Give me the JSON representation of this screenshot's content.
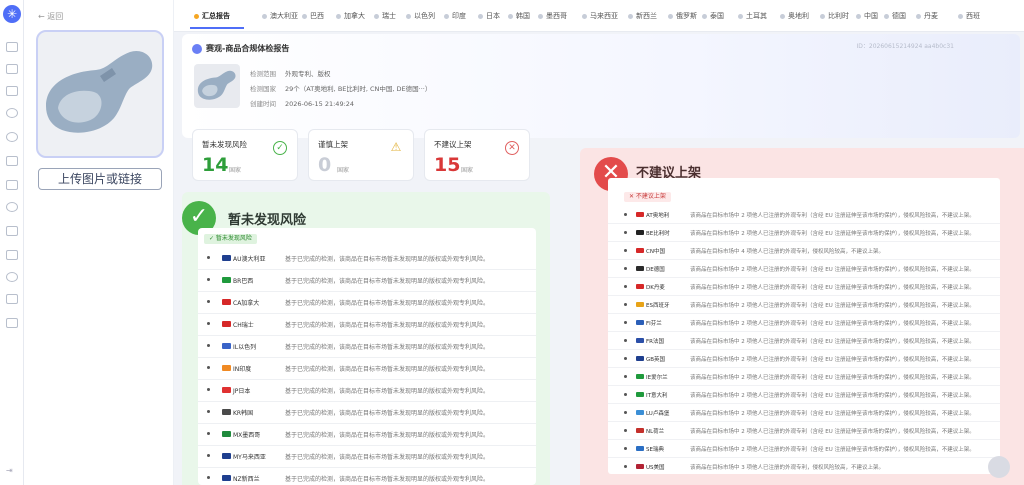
{
  "sidebar_left": {
    "back_label": "← 返回",
    "upload_button": "上传图片或链接"
  },
  "tabs": [
    {
      "label": "汇总报告",
      "active": true
    },
    {
      "label": "澳大利亚"
    },
    {
      "label": "巴西"
    },
    {
      "label": "加拿大"
    },
    {
      "label": "瑞士"
    },
    {
      "label": "以色列"
    },
    {
      "label": "印度"
    },
    {
      "label": "日本"
    },
    {
      "label": "韩国"
    },
    {
      "label": "墨西哥"
    },
    {
      "label": "马来西亚"
    },
    {
      "label": "新西兰"
    },
    {
      "label": "俄罗斯"
    },
    {
      "label": "泰国"
    },
    {
      "label": "土耳其"
    },
    {
      "label": "奥地利"
    },
    {
      "label": "比利时"
    },
    {
      "label": "中国"
    },
    {
      "label": "德国"
    },
    {
      "label": "丹麦"
    },
    {
      "label": "西班"
    }
  ],
  "report": {
    "title": "赛观-商品合规体检报告",
    "report_id": "ID：20260615214924 aa4b0c31",
    "scope_label": "检测范围",
    "scope_value": "外观专利、版权",
    "countries_label": "检测国家",
    "countries_value": "29个（AT奥地利, BE比利时, CN中国, DE德国···）",
    "created_label": "创建时间",
    "created_value": "2026-06-15 21:49:24"
  },
  "summary_cards": [
    {
      "title": "暂未发现风险",
      "count": "14",
      "unit": "国家",
      "color": "#2e9e3a",
      "icon": "check-circle-icon"
    },
    {
      "title": "谨慎上架",
      "count": "0",
      "unit": "国家",
      "color": "#c9cdd6",
      "icon": "warning-triangle-icon"
    },
    {
      "title": "不建议上架",
      "count": "15",
      "unit": "国家",
      "color": "#d93838",
      "icon": "x-circle-icon"
    }
  ],
  "no_risk": {
    "heading": "暂未发现风险",
    "badge": "✓ 暂未发现风险",
    "rows": [
      {
        "country": "AU澳大利亚",
        "flag": "#1f3f8f",
        "desc": "基于已完成的检测，该商品在目标市场暂未发现明显的版权或外观专利风险。"
      },
      {
        "country": "BR巴西",
        "flag": "#1f9a3c",
        "desc": "基于已完成的检测，该商品在目标市场暂未发现明显的版权或外观专利风险。"
      },
      {
        "country": "CA加拿大",
        "flag": "#d62828",
        "desc": "基于已完成的检测，该商品在目标市场暂未发现明显的版权或外观专利风险。"
      },
      {
        "country": "CH瑞士",
        "flag": "#d62828",
        "desc": "基于已完成的检测，该商品在目标市场暂未发现明显的版权或外观专利风险。"
      },
      {
        "country": "IL以色列",
        "flag": "#3a64c8",
        "desc": "基于已完成的检测，该商品在目标市场暂未发现明显的版权或外观专利风险。"
      },
      {
        "country": "IN印度",
        "flag": "#f08a24",
        "desc": "基于已完成的检测，该商品在目标市场暂未发现明显的版权或外观专利风险。"
      },
      {
        "country": "JP日本",
        "flag": "#e03131",
        "desc": "基于已完成的检测，该商品在目标市场暂未发现明显的版权或外观专利风险。"
      },
      {
        "country": "KR韩国",
        "flag": "#4a4a4a",
        "desc": "基于已完成的检测，该商品在目标市场暂未发现明显的版权或外观专利风险。"
      },
      {
        "country": "MX墨西哥",
        "flag": "#1f8a3c",
        "desc": "基于已完成的检测，该商品在目标市场暂未发现明显的版权或外观专利风险。"
      },
      {
        "country": "MY马来西亚",
        "flag": "#1f3f8f",
        "desc": "基于已完成的检测，该商品在目标市场暂未发现明显的版权或外观专利风险。"
      },
      {
        "country": "NZ新西兰",
        "flag": "#1f3f8f",
        "desc": "基于已完成的检测，该商品在目标市场暂未发现明显的版权或外观专利风险。"
      }
    ]
  },
  "not_recommended": {
    "heading": "不建议上架",
    "badge": "✕ 不建议上架",
    "rows": [
      {
        "country": "AT奥地利",
        "flag": "#d62828",
        "desc": "该商品在目标市场中 2 项他人已注册的外观专利（含经 EU 注册延伸至该市场的保护），侵权风险较高，不建议上架。"
      },
      {
        "country": "BE比利时",
        "flag": "#222222",
        "desc": "该商品在目标市场中 2 项他人已注册的外观专利（含经 EU 注册延伸至该市场的保护），侵权风险较高，不建议上架。"
      },
      {
        "country": "CN中国",
        "flag": "#d62828",
        "desc": "该商品在目标市场中 4 项他人已注册的外观专利，侵权风险较高，不建议上架。"
      },
      {
        "country": "DE德国",
        "flag": "#2b2b2b",
        "desc": "该商品在目标市场中 2 项他人已注册的外观专利（含经 EU 注册延伸至该市场的保护），侵权风险较高，不建议上架。"
      },
      {
        "country": "DK丹麦",
        "flag": "#d62828",
        "desc": "该商品在目标市场中 2 项他人已注册的外观专利（含经 EU 注册延伸至该市场的保护），侵权风险较高，不建议上架。"
      },
      {
        "country": "ES西班牙",
        "flag": "#e8a317",
        "desc": "该商品在目标市场中 2 项他人已注册的外观专利（含经 EU 注册延伸至该市场的保护），侵权风险较高，不建议上架。"
      },
      {
        "country": "FI芬兰",
        "flag": "#2b5fb8",
        "desc": "该商品在目标市场中 2 项他人已注册的外观专利（含经 EU 注册延伸至该市场的保护），侵权风险较高，不建议上架。"
      },
      {
        "country": "FR法国",
        "flag": "#2b4fa8",
        "desc": "该商品在目标市场中 2 项他人已注册的外观专利（含经 EU 注册延伸至该市场的保护），侵权风险较高，不建议上架。"
      },
      {
        "country": "GB英国",
        "flag": "#1f3f8f",
        "desc": "该商品在目标市场中 2 项他人已注册的外观专利（含经 EU 注册延伸至该市场的保护），侵权风险较高，不建议上架。"
      },
      {
        "country": "IE爱尔兰",
        "flag": "#1f9a3c",
        "desc": "该商品在目标市场中 2 项他人已注册的外观专利（含经 EU 注册延伸至该市场的保护），侵权风险较高，不建议上架。"
      },
      {
        "country": "IT意大利",
        "flag": "#1f9a3c",
        "desc": "该商品在目标市场中 2 项他人已注册的外观专利（含经 EU 注册延伸至该市场的保护），侵权风险较高，不建议上架。"
      },
      {
        "country": "LU卢森堡",
        "flag": "#3b8fd6",
        "desc": "该商品在目标市场中 2 项他人已注册的外观专利（含经 EU 注册延伸至该市场的保护），侵权风险较高，不建议上架。"
      },
      {
        "country": "NL荷兰",
        "flag": "#c4302b",
        "desc": "该商品在目标市场中 2 项他人已注册的外观专利（含经 EU 注册延伸至该市场的保护），侵权风险较高，不建议上架。"
      },
      {
        "country": "SE瑞典",
        "flag": "#2b6fc4",
        "desc": "该商品在目标市场中 2 项他人已注册的外观专利（含经 EU 注册延伸至该市场的保护），侵权风险较高，不建议上架。"
      },
      {
        "country": "US美国",
        "flag": "#b22234",
        "desc": "该商品在目标市场中 3 项他人已注册的外观专利，侵权风险较高，不建议上架。"
      }
    ]
  }
}
